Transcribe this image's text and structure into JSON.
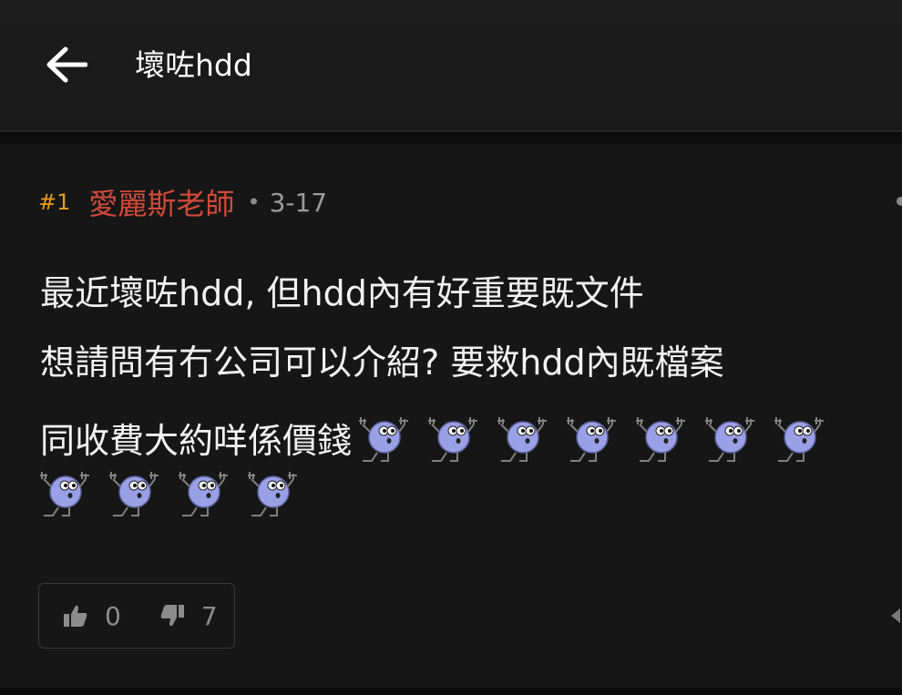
{
  "header": {
    "title": "壞咗hdd",
    "back_icon": "arrow-left-icon"
  },
  "post": {
    "number": "#1",
    "author": "愛麗斯老師",
    "separator": "•",
    "date": "3-17",
    "lines": [
      "最近壞咗hdd, 但hdd內有好重要既文件",
      "想請問有冇公司可以介紹? 要救hdd內既檔案",
      "同收費大約咩係價錢"
    ],
    "emoji_icon": "lm-sticker-icon",
    "emoji_count_row1": 7,
    "emoji_count_row2": 4,
    "likes": "0",
    "dislikes": "7"
  },
  "colors": {
    "background": "#0d0d0d",
    "header_bg": "#1c1c1c",
    "post_bg": "#161616",
    "post_number": "#e29c1f",
    "author": "#d14a39",
    "text": "#f2f2f2",
    "muted": "#9a9a9a",
    "emoji_fill": "#9aa0e6"
  }
}
